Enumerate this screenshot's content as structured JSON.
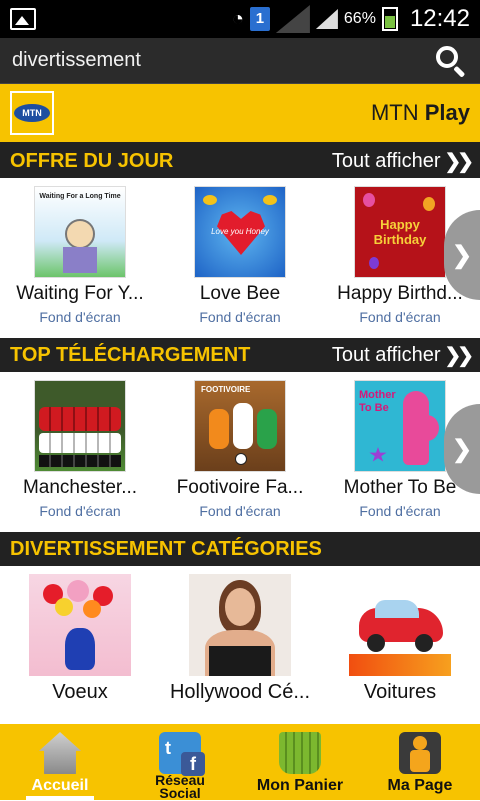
{
  "status": {
    "sim": "1",
    "battery": "66%",
    "time": "12:42"
  },
  "search": {
    "query": "divertissement"
  },
  "brand": {
    "name_light": "MTN",
    "name_bold": "Play",
    "logo_text": "MTN"
  },
  "sections": [
    {
      "title": "OFFRE DU JOUR",
      "see_all": "Tout afficher",
      "items": [
        {
          "title": "Waiting For Y...",
          "sub": "Fond d'écran",
          "thumb_text": "Waiting For a Long Time"
        },
        {
          "title": "Love Bee",
          "sub": "Fond d'écran",
          "thumb_text": "Love you Honey"
        },
        {
          "title": "Happy Birthd...",
          "sub": "Fond d'écran",
          "thumb_text": "Happy Birthday"
        }
      ]
    },
    {
      "title": "TOP TÉLÉCHARGEMENT",
      "see_all": "Tout afficher",
      "items": [
        {
          "title": "Manchester...",
          "sub": "Fond d'écran",
          "thumb_text": ""
        },
        {
          "title": "Footivoire Fa...",
          "sub": "Fond d'écran",
          "thumb_text": "FOOTIVOIRE"
        },
        {
          "title": "Mother To Be",
          "sub": "Fond d'écran",
          "thumb_text": "Mother To Be"
        }
      ]
    },
    {
      "title": "DIVERTISSEMENT CATÉGORIES",
      "items": [
        {
          "title": "Voeux"
        },
        {
          "title": "Hollywood Cé..."
        },
        {
          "title": "Voitures"
        }
      ]
    }
  ],
  "tabs": [
    {
      "label": "Accueil",
      "icon": "home-icon"
    },
    {
      "label": "Réseau Social",
      "icon": "social-icon"
    },
    {
      "label": "Mon Panier",
      "icon": "basket-icon"
    },
    {
      "label": "Ma Page",
      "icon": "profile-icon"
    }
  ],
  "colors": {
    "accent": "#f7c300",
    "dark": "#222222",
    "sub_text": "#4f6fa2"
  }
}
